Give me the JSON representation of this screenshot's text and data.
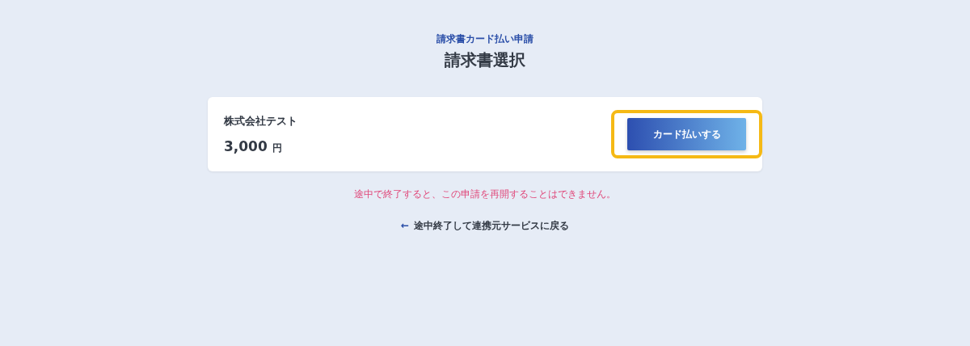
{
  "header": {
    "subtitle": "請求書カード払い申請",
    "title": "請求書選択"
  },
  "invoice": {
    "company": "株式会社テスト",
    "amount": "3,000",
    "currency": "円",
    "button": "カード払いする",
    "highlighted": true
  },
  "warning": "途中で終了すると、この申請を再開することはできません。",
  "back_link": {
    "icon": "←",
    "label": "途中終了して連携元サービスに戻る"
  }
}
